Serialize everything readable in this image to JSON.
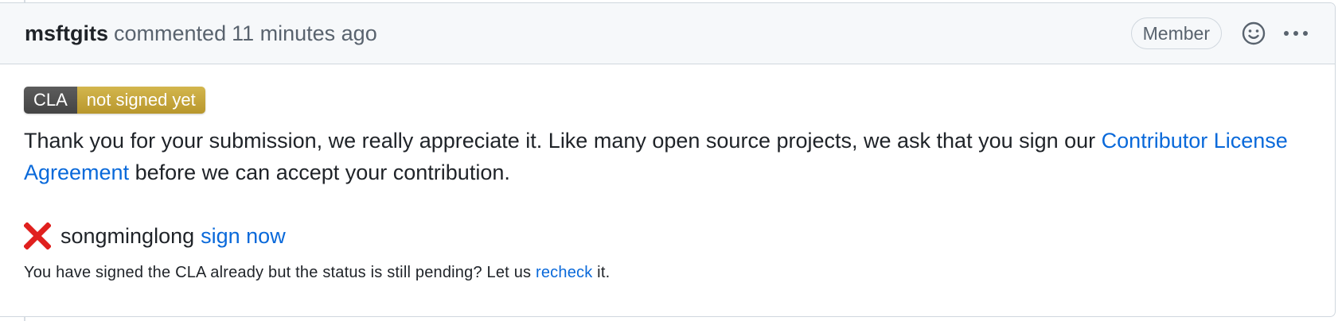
{
  "header": {
    "author": "msftgits",
    "verb": "commented",
    "timestamp": "11 minutes ago",
    "role_badge": "Member",
    "emoji_icon": "smiley-icon",
    "more_icon": "kebab-horizontal-icon"
  },
  "badge": {
    "left": "CLA",
    "right": "not signed yet",
    "left_color": "#555555",
    "right_color": "#c9a93b"
  },
  "body": {
    "message_prefix": "Thank you for your submission, we really appreciate it. Like many open source projects, we ask that you sign our ",
    "agreement_link": "Contributor License Agreement",
    "message_suffix": " before we can accept your contribution.",
    "status_icon": "red-x-icon",
    "signer": "songminglong",
    "sign_link": "sign now",
    "note_prefix": "You have signed the CLA already but the status is still pending? Let us ",
    "recheck_link": "recheck",
    "note_suffix": " it."
  },
  "colors": {
    "link": "#0969da",
    "error": "#e0201e",
    "header_bg": "#f6f8fa",
    "border": "#d0d7de"
  }
}
